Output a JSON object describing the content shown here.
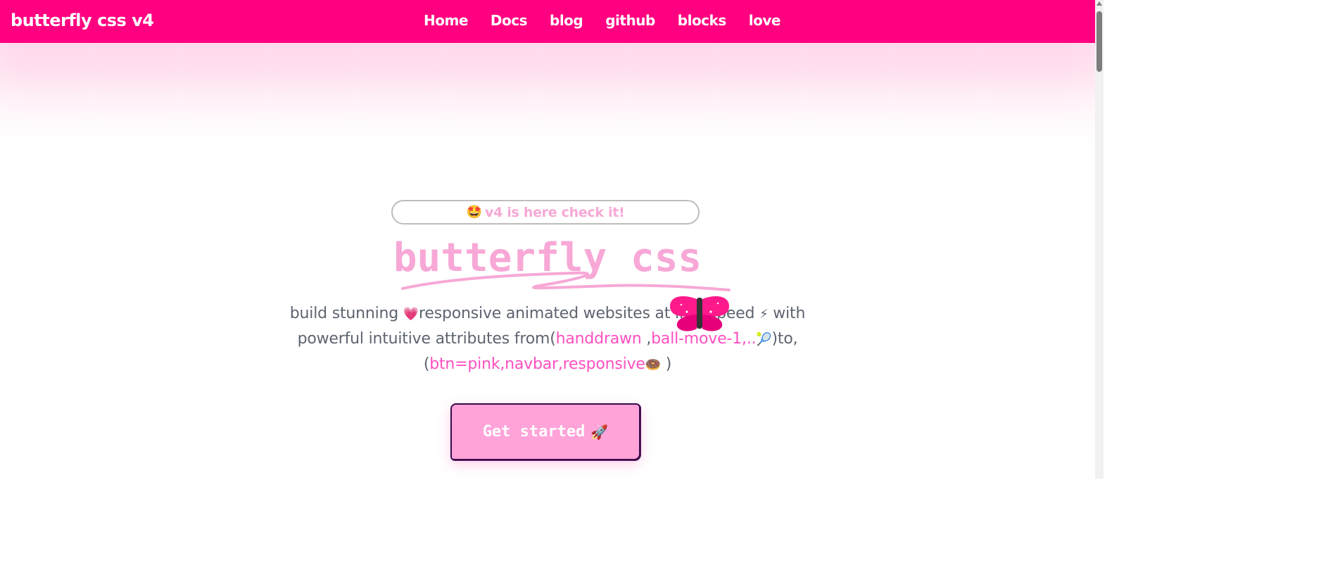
{
  "navbar": {
    "brand": "butterfly css v4",
    "links": [
      "Home",
      "Docs",
      "blog",
      "github",
      "blocks",
      "love"
    ]
  },
  "announcement": {
    "emoji": "🤩",
    "text": "v4 is here check it!"
  },
  "hero": {
    "title": "butterfly css",
    "desc_line1_a": "build stunning ",
    "desc_emoji_heart": "💗",
    "desc_line1_b": "responsive animated websites at lightspeed ",
    "desc_emoji_bolt": "⚡",
    "desc_line1_c": " with",
    "desc_line2_a": "powerful intuitive attributes from(",
    "desc_link_1": "handdrawn",
    "desc_line2_sep": " ,",
    "desc_link_2": "ball-move-1,..",
    "desc_emoji_racket": "🎾",
    "desc_line2_b": ")to,",
    "desc_line3_a": "(",
    "desc_link_3": "btn=pink,navbar,responsive",
    "desc_emoji_donut": "🍩",
    "desc_line3_b": " )"
  },
  "cta": {
    "label": "Get started",
    "emoji": "🚀"
  },
  "colors": {
    "brand_pink": "#ff0080",
    "soft_pink": "#f7a8d6",
    "button_pink": "#ffa3d9",
    "link_pink": "#ff4fc0",
    "body_text": "#5d6470"
  },
  "icons": {
    "butterfly": "butterfly-icon",
    "pill": "star-eyes-emoji"
  }
}
